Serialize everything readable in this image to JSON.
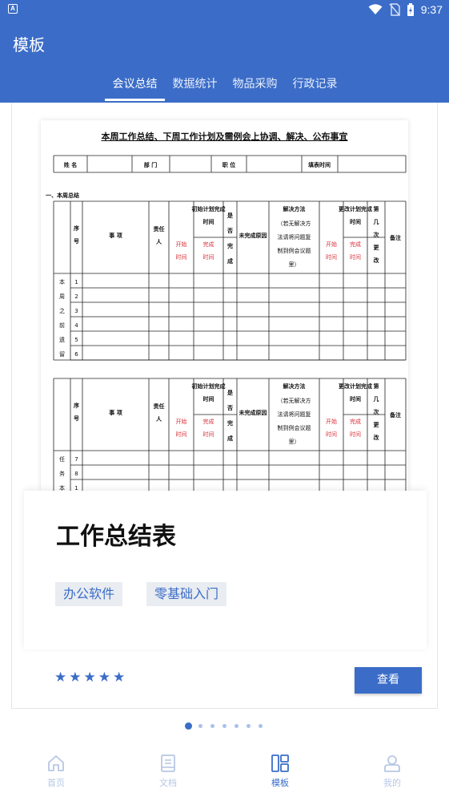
{
  "status_bar": {
    "time": "9:37",
    "app_icon_letter": "A"
  },
  "header": {
    "title": "模板"
  },
  "tabs": [
    {
      "label": "会议总结",
      "active": true
    },
    {
      "label": "数据统计",
      "active": false
    },
    {
      "label": "物品采购",
      "active": false
    },
    {
      "label": "行政记录",
      "active": false
    }
  ],
  "document": {
    "title": "本周工作总结、下周工作计划及需例会上协调、解决、公布事宜",
    "info_row": [
      "姓 名",
      "部 门",
      "职 位",
      "填表时间"
    ],
    "section1": "一、本周总结",
    "headers": {
      "seq": "序号",
      "item": "事 项",
      "owner": "责任人",
      "initial_plan": "初始计划完成时间",
      "start": "开始时间",
      "finish": "完成时间",
      "done": "是否完成",
      "reason": "未完成原因",
      "solution": "解决方法（若无解决方法请将问题复制到例会议题里）",
      "changed_plan": "更改计划完成时间",
      "nth_change": "第几次更改",
      "remark": "备注"
    },
    "group1_label": [
      "本",
      "周",
      "之",
      "前",
      "遗",
      "留"
    ],
    "group1_rows": [
      "1",
      "2",
      "3",
      "4",
      "5",
      "6"
    ],
    "group2_label": [
      "任",
      "务",
      "本"
    ],
    "group2_rows": [
      "7",
      "8",
      "1"
    ]
  },
  "card": {
    "title": "工作总结表",
    "tags": [
      "办公软件",
      "零基础入门"
    ],
    "rating": 5,
    "view_button": "查看"
  },
  "pager": {
    "count": 7,
    "active_index": 0
  },
  "bottom_nav": [
    {
      "label": "首页",
      "icon": "home-icon",
      "active": false
    },
    {
      "label": "文档",
      "icon": "document-icon",
      "active": false
    },
    {
      "label": "模板",
      "icon": "template-icon",
      "active": true
    },
    {
      "label": "我的",
      "icon": "profile-icon",
      "active": false
    }
  ],
  "colors": {
    "primary": "#3b6dc8",
    "inactive_nav": "#b7c7e4",
    "tag_bg": "#e9ecf1",
    "doc_red": "#d8313a"
  }
}
